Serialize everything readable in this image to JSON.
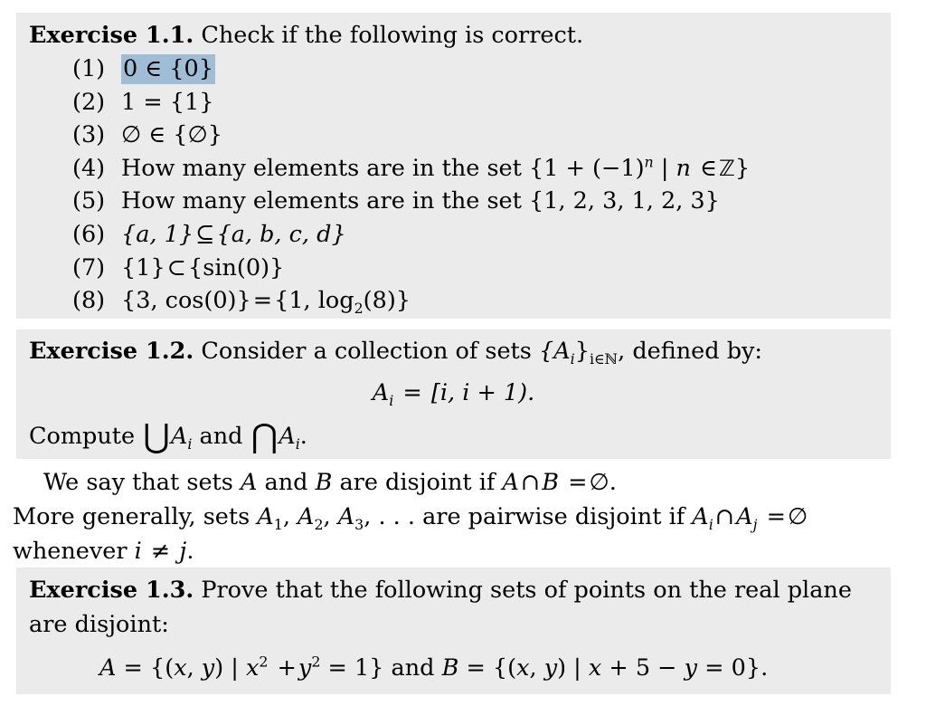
{
  "document": {
    "background": "#ffffff",
    "block_shade": "#ebebeb",
    "highlight_color": "#9fbdd4"
  },
  "exercise_1_1": {
    "label": "Exercise 1.1.",
    "prompt": "Check if the following is correct.",
    "items": [
      {
        "number": "(1)",
        "text": "0 ∈ {0}",
        "highlighted": true
      },
      {
        "number": "(2)",
        "text": "1 = {1}",
        "highlighted": false
      },
      {
        "number": "(3)",
        "text": "∅ ∈ {∅}",
        "highlighted": false
      },
      {
        "number": "(4)",
        "text": "How many elements are in the set {1 + (−1)ⁿ | n ∈ ℤ}",
        "highlighted": false
      },
      {
        "number": "(5)",
        "text": "How many elements are in the set {1, 2, 3, 1, 2, 3}",
        "highlighted": false
      },
      {
        "number": "(6)",
        "text": "{a, 1} ⊆ {a, b, c, d}",
        "highlighted": false
      },
      {
        "number": "(7)",
        "text": "{1} ⊂ {sin(0)}",
        "highlighted": false
      },
      {
        "number": "(8)",
        "text": "{3, cos(0)} = {1, log₂(8)}",
        "highlighted": false
      }
    ],
    "item4": {
      "lead": "How many elements are in the set",
      "set_open": "{1 + (−1)",
      "exponent": "n",
      "mid": "| ",
      "var": "n",
      "member": "∈",
      "domain": "ℤ",
      "close": "}"
    },
    "item5": {
      "lead": "How many elements are in the set",
      "set": "{1, 2, 3, 1, 2, 3}"
    },
    "item6": {
      "left": "{a, 1}",
      "rel": "⊆",
      "right": "{a, b, c, d}"
    },
    "item7": {
      "left": "{1}",
      "rel": "⊂",
      "right": "{sin(0)}"
    },
    "item8": {
      "left": "{3, cos(0)}",
      "rel": "=",
      "right_open": "{1, log",
      "sub": "2",
      "right_close": "(8)}"
    }
  },
  "exercise_1_2": {
    "label": "Exercise 1.2.",
    "prompt_before": "Consider a collection of sets",
    "family_open": "{A",
    "family_sub": "i",
    "family_close": "}",
    "family_index_sub": "i∈ℕ",
    "prompt_after": ", defined by:",
    "display": {
      "lhs_base": "A",
      "lhs_sub": "i",
      "eq": "=",
      "rhs": "[i, i + 1)."
    },
    "compute_line": {
      "word": "Compute",
      "union": "⋃",
      "set_base": "A",
      "set_sub": "i",
      "and": "and",
      "intersection": "⋂",
      "end": "."
    }
  },
  "disjoint_paragraph": {
    "line1": {
      "a": "We say that sets",
      "varA": "A",
      "b": "and",
      "varB": "B",
      "c": "are disjoint if",
      "expr_A": "A",
      "cap": "∩",
      "expr_B": "B",
      "eq": "=",
      "empty": "∅",
      "period": "."
    },
    "line2": {
      "a": "More generally, sets",
      "A1": "A",
      "A1sub": "1",
      "A2": "A",
      "A2sub": "2",
      "A3": "A",
      "A3sub": "3",
      "dots": ", . . .",
      "b": "are pairwise disjoint if",
      "Ai": "A",
      "Aisub": "i",
      "cap": "∩",
      "Aj": "A",
      "Ajsub": "j",
      "eq": "=",
      "empty": "∅"
    },
    "line3": {
      "a": "whenever",
      "i": "i",
      "neq": "≠",
      "j": "j",
      "period": "."
    }
  },
  "exercise_1_3": {
    "label": "Exercise 1.3.",
    "prompt_line1": "Prove that the following sets of points on the real plane",
    "prompt_line2": "are disjoint:",
    "display": {
      "A": "A",
      "eq1": "= {(",
      "x1": "x",
      "comma1": ", ",
      "y1": "y",
      "mid1": ") | ",
      "x2": "x",
      "sup2a": "2",
      "plus": "+",
      "y2": "y",
      "sup2b": "2",
      "eq2": "= 1}",
      "and": "and",
      "B": "B",
      "eq3": "= {(",
      "x3": "x",
      "comma2": ", ",
      "y3": "y",
      "mid2": ") | ",
      "x4": "x",
      "plus5": "+ 5 −",
      "y4": "y",
      "eq4": "= 0}."
    }
  }
}
